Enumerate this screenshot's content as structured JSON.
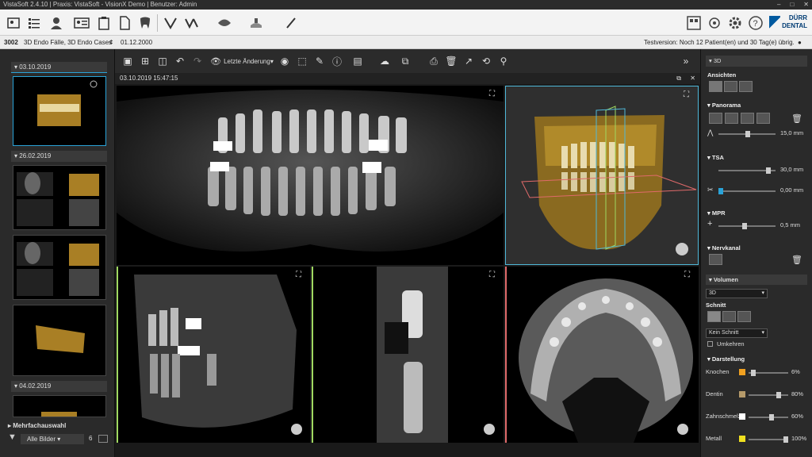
{
  "window": {
    "title": "VistaSoft 2.4.10 | Praxis: VistaSoft - VisionX Demo | Benutzer: Admin",
    "controls": [
      "–",
      "□",
      "✕"
    ]
  },
  "toolbar": {
    "icons": [
      "patient-image-icon",
      "patient-list-icon",
      "user-icon",
      "patient-card-icon",
      "clipboard-icon",
      "document-icon",
      "tooth-icon",
      "intraoral-icon",
      "xray-icon",
      "panorama-icon",
      "ceph-icon",
      "volume-icon",
      "pen-icon"
    ],
    "right_icons": [
      "workstation-icon",
      "network-icon",
      "settings-icon",
      "help-icon"
    ],
    "logo_line1": "DÜRR",
    "logo_line2": "DENTAL"
  },
  "infobar": {
    "patient_id": "3002",
    "patient_name": "3D Endo Fälle, 3D Endo Cases",
    "dob": "01.12.2000",
    "test_notice": "Testversion: Noch 12 Patient(en) und 30 Tag(e) übrig."
  },
  "left_panel": {
    "groups": [
      {
        "date": "03.10.2019"
      },
      {
        "date": "26.02.2019"
      },
      {
        "date": "04.02.2019"
      }
    ],
    "multiselect_label": "Mehrfachauswahl",
    "filter_label": "Alle Bilder",
    "count": "6"
  },
  "viewer": {
    "last_change_label": "Letzte Änderung",
    "timestamp": "03.10.2019 15:47:15"
  },
  "right_panel": {
    "section_3d": "3D",
    "views_label": "Ansichten",
    "panorama_label": "Panorama",
    "panorama_value": "15,0 mm",
    "tsa_label": "TSA",
    "tsa_value1": "30,0 mm",
    "tsa_value2": "0,00 mm",
    "mpr_label": "MPR",
    "mpr_value": "0,5 mm",
    "nerve_label": "Nervkanal",
    "volume_label": "Volumen",
    "volume_select": "3D",
    "cut_label": "Schnitt",
    "cut_select": "Kein Schnitt",
    "invert_label": "Umkehren",
    "display_label": "Darstellung",
    "materials": [
      {
        "name": "Knochen",
        "value": "6%",
        "color": "#f0a020",
        "fill": 0.06
      },
      {
        "name": "Dentin",
        "value": "80%",
        "color": "#b59a6a",
        "fill": 0.8
      },
      {
        "name": "Zahnschmelz",
        "value": "60%",
        "color": "#ffffff",
        "fill": 0.6
      },
      {
        "name": "Metall",
        "value": "100%",
        "color": "#f0e020",
        "fill": 1.0
      }
    ]
  },
  "colors": {
    "accent": "#2aa3d8",
    "dark_bg": "#2a2a2a",
    "volume_gold": "#b08a2a",
    "plane_blue": "#4fb8d8",
    "plane_green": "#9fd860",
    "plane_red": "#e06a6a"
  }
}
